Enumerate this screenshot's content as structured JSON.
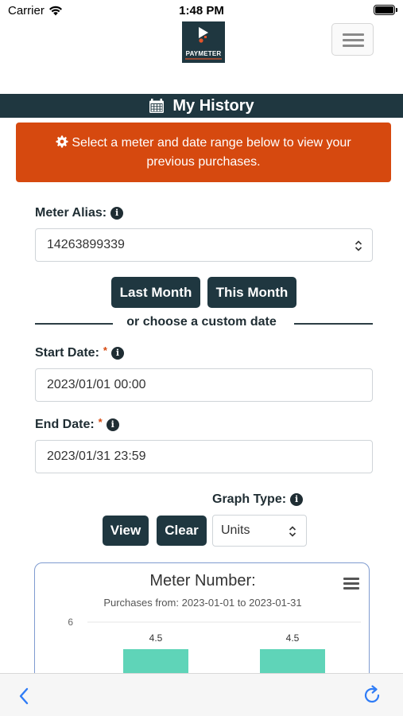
{
  "status": {
    "carrier": "Carrier",
    "time": "1:48 PM"
  },
  "logo": {
    "text": "PAYMETER"
  },
  "header": {
    "title": "My History"
  },
  "alert": {
    "line1": "Select a meter and date range below to view your",
    "line2": "previous purchases."
  },
  "meter": {
    "label": "Meter Alias:",
    "value": "14263899339"
  },
  "quick": {
    "last_month": "Last Month",
    "this_month": "This Month",
    "divider": "or choose a custom date"
  },
  "start": {
    "label": "Start Date:",
    "required": "*",
    "value": "2023/01/01 00:00"
  },
  "end": {
    "label": "End Date:",
    "required": "*",
    "value": "2023/01/31 23:59"
  },
  "graph": {
    "label": "Graph Type:",
    "value": "Units"
  },
  "actions": {
    "view": "View",
    "clear": "Clear"
  },
  "chart_data": {
    "type": "bar",
    "title": "Meter Number:",
    "subtitle": "Purchases from: 2023-01-01 to 2023-01-31",
    "ytick_labels": [
      "6"
    ],
    "data_labels": [
      "4.5",
      "4.5"
    ],
    "values": [
      4.5,
      4.5
    ],
    "ylim": [
      0,
      6
    ],
    "bar_color": "#5fd4b8"
  },
  "colors": {
    "brand": "#1f3740",
    "accent": "#d6490f"
  }
}
